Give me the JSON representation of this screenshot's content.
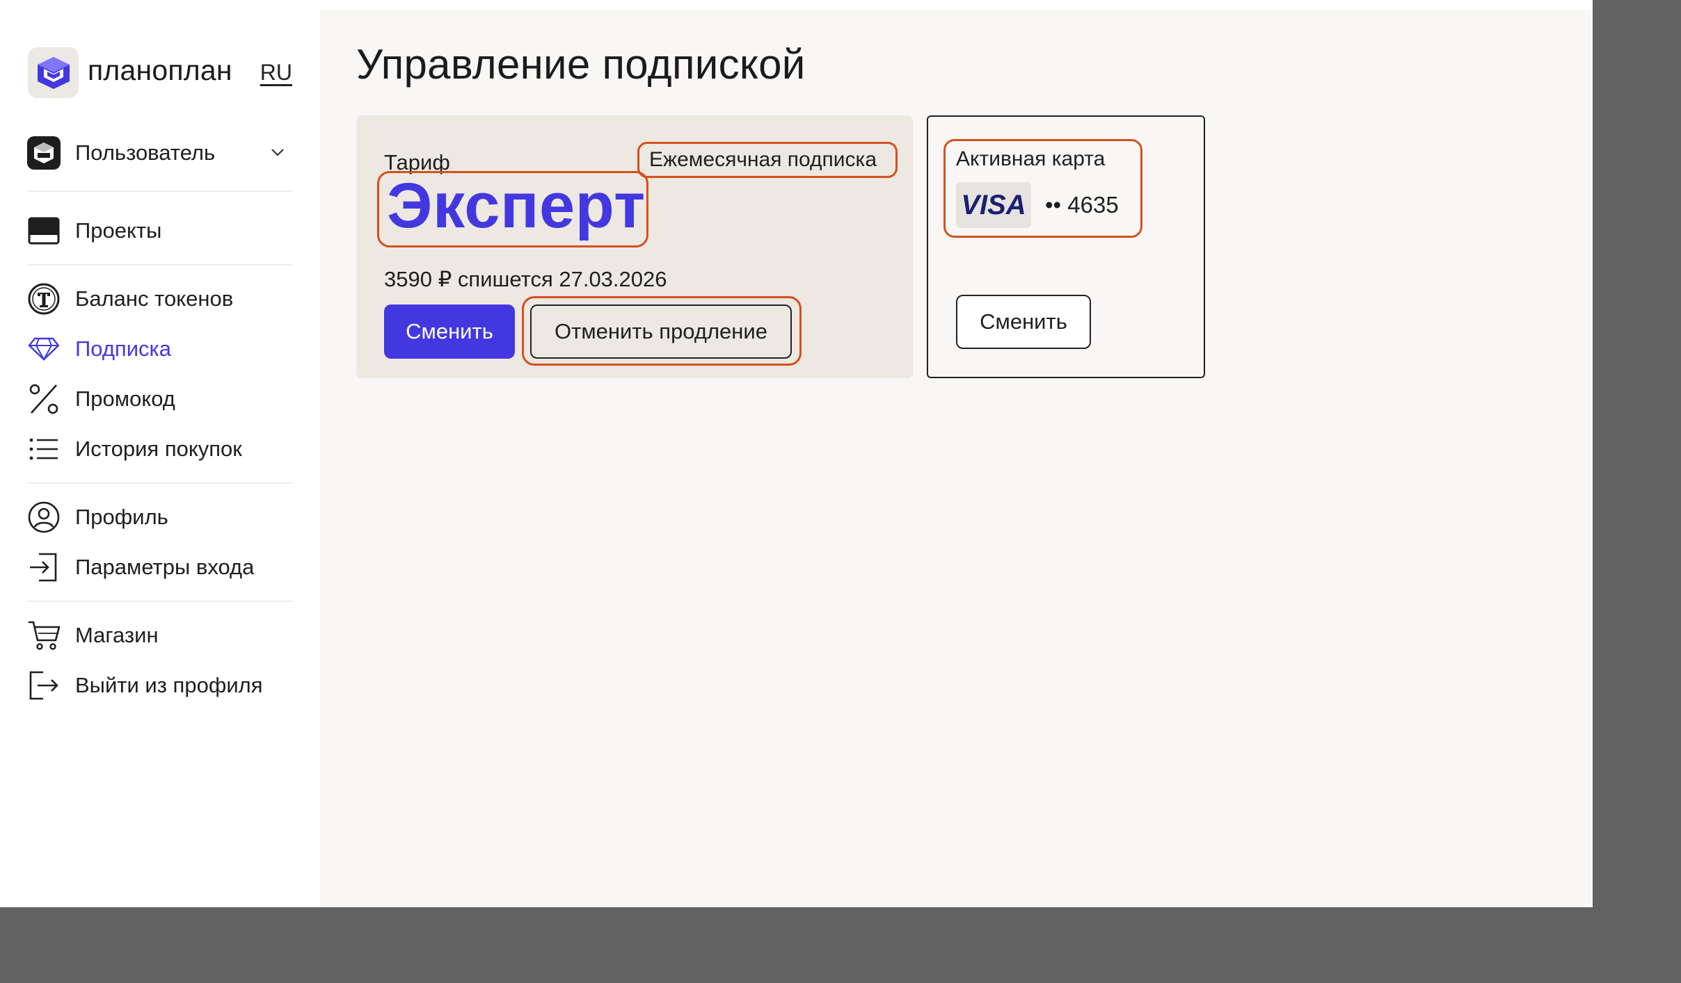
{
  "brand": {
    "name": "планоплан",
    "lang": "RU"
  },
  "sidebar": {
    "user": {
      "label": "Пользователь"
    },
    "items": [
      {
        "key": "projects",
        "label": "Проекты",
        "icon": "projects-icon"
      },
      {
        "key": "tokens",
        "label": "Баланс токенов",
        "icon": "token-icon"
      },
      {
        "key": "subscription",
        "label": "Подписка",
        "icon": "diamond-icon",
        "active": true
      },
      {
        "key": "promo",
        "label": "Промокод",
        "icon": "percent-icon"
      },
      {
        "key": "history",
        "label": "История покупок",
        "icon": "list-icon"
      },
      {
        "key": "profile",
        "label": "Профиль",
        "icon": "user-circle-icon"
      },
      {
        "key": "login",
        "label": "Параметры входа",
        "icon": "sign-in-icon"
      },
      {
        "key": "shop",
        "label": "Магазин",
        "icon": "cart-icon"
      },
      {
        "key": "logout",
        "label": "Выйти из профиля",
        "icon": "sign-out-icon"
      }
    ]
  },
  "main": {
    "title": "Управление подпиской",
    "plan": {
      "label": "Тариф",
      "period": "Ежемесячная подписка",
      "name": "Эксперт",
      "charge": "3590 ₽ спишется 27.03.2026",
      "change_button": "Сменить",
      "cancel_button": "Отменить продление"
    },
    "card": {
      "title": "Активная карта",
      "brand": "VISA",
      "number": "•• 4635",
      "change_button": "Сменить"
    }
  },
  "colors": {
    "accent": "#4338e0",
    "highlight": "#d4511d",
    "plan_card_bg": "#ede8e2",
    "main_bg": "#f8f7f5",
    "backdrop": "#626262"
  }
}
